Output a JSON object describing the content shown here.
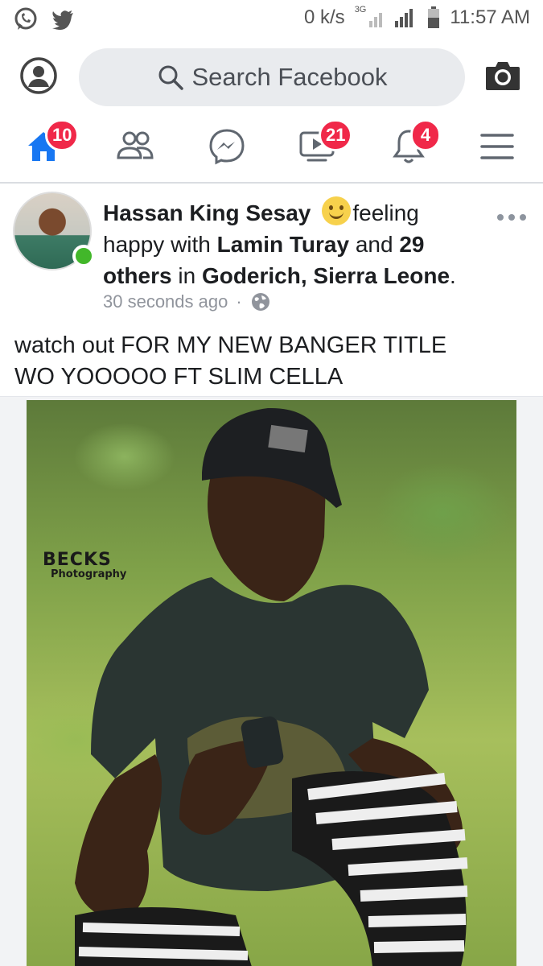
{
  "status_bar": {
    "speed": "0 k/s",
    "network": "3G",
    "time": "11:57 AM",
    "left_icons": [
      "whatsapp-icon",
      "twitter-icon"
    ]
  },
  "search": {
    "placeholder": "Search Facebook"
  },
  "nav": {
    "home_badge": "10",
    "watch_badge": "21",
    "notifications_badge": "4",
    "accent": "#1877f2",
    "badge_color": "#f02849"
  },
  "post": {
    "author": "Hassan King Sesay",
    "feeling": "feeling",
    "happy_with": "happy with",
    "tagged": "Lamin Turay",
    "and_text": "and",
    "others": "29 others",
    "in_text": "in",
    "location": "Goderich, Sierra Leone",
    "period": ".",
    "timestamp": "30 seconds ago",
    "separator": "·",
    "text_line1": "watch out FOR MY NEW BANGER TITLE",
    "text_line2": "WO YOOOOO FT SLIM CELLA"
  },
  "photo": {
    "watermark_main": "BECKS",
    "watermark_sub": "Photography"
  }
}
